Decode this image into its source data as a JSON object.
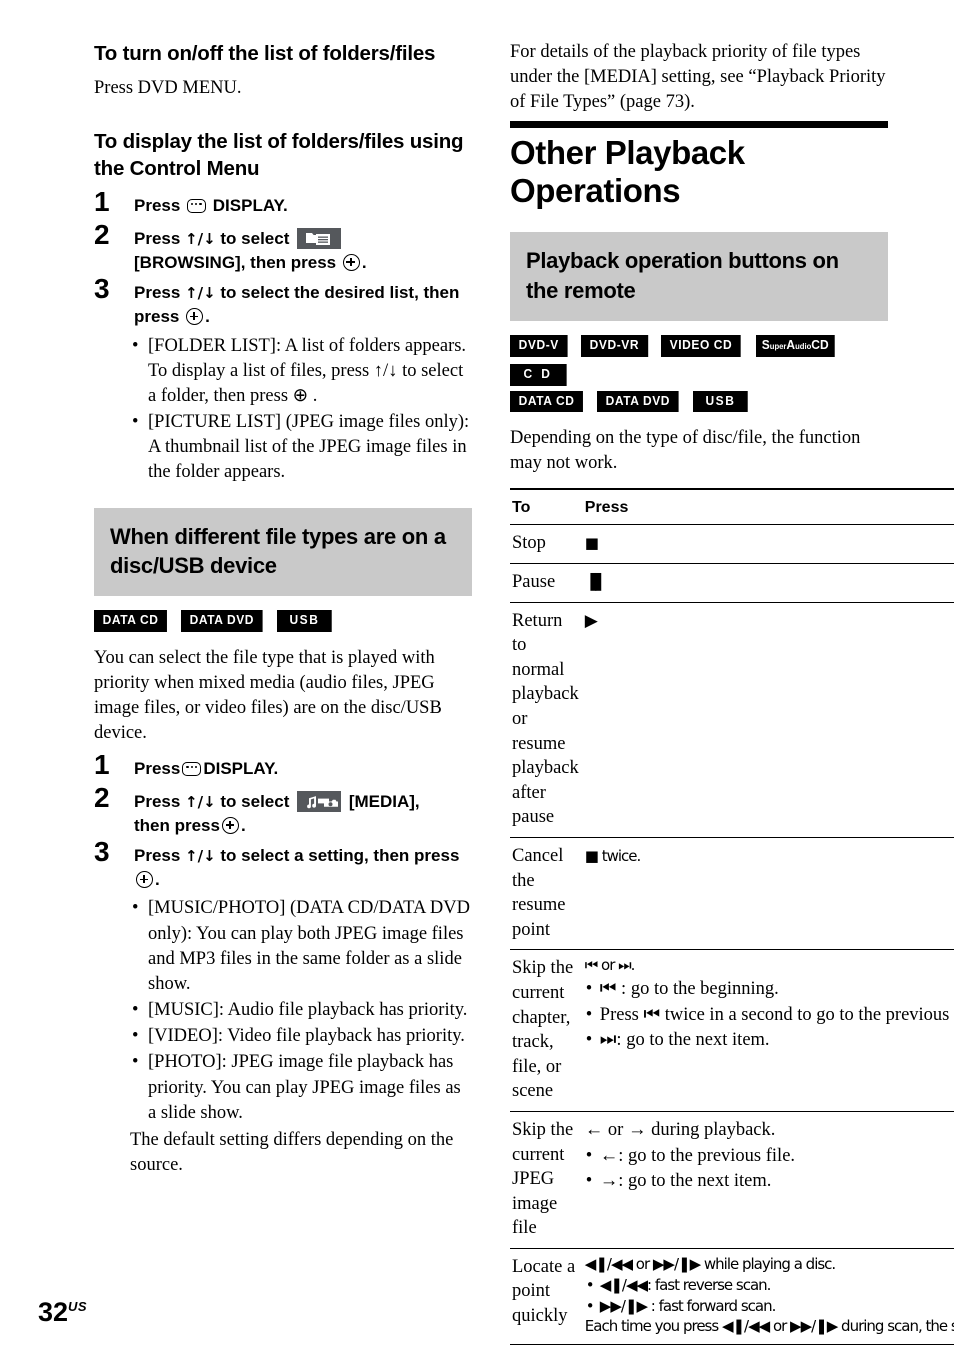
{
  "page": {
    "number": "32",
    "region": "US"
  },
  "left_column": {
    "heading_1": "To turn on/off the list of folders/files",
    "para_1": "Press DVD MENU.",
    "heading_2": "To display the list of folders/files using the Control Menu",
    "steps_1": [
      {
        "num": "1",
        "parts": [
          "Press ",
          "DISPLAY."
        ],
        "icon": "display-icon"
      },
      {
        "num": "2",
        "parts": [
          "Press ",
          "↑/↓",
          " to select ",
          "[BROWSING], then press ",
          "."
        ],
        "icon": "browsing-icon"
      },
      {
        "num": "3",
        "parts": [
          "Press ",
          "↑/↓",
          " to select the desired list, then press ",
          "."
        ]
      }
    ],
    "step3_bullets": [
      "[FOLDER LIST]: A list of folders appears. To display a list of files, press ↑/↓ to select a folder, then press ⊕ .",
      "[PICTURE LIST] (JPEG image files only): A thumbnail list of the JPEG image files in the folder appears."
    ],
    "gray_heading": "When different file types are on a disc/USB device",
    "badges": [
      "DATA CD",
      "DATA DVD",
      "USB"
    ],
    "para_2": "You can select the file type that is played with priority when mixed media (audio files, JPEG image files, or video files) are on the disc/USB device.",
    "steps_2": [
      {
        "num": "1",
        "label": "Press DISPLAY."
      },
      {
        "num": "2",
        "label": "Press ↑/↓ to select [MEDIA], then press ⊕ ."
      },
      {
        "num": "3",
        "label": "Press ↑/↓ to select a setting, then press ⊕ ."
      }
    ],
    "media_bullets": [
      "[MUSIC/PHOTO] (DATA CD/DATA DVD only): You can play both JPEG image files and MP3 files in the same folder as a slide show.",
      "[MUSIC]: Audio file playback has priority.",
      "[VIDEO]: Video file playback has priority.",
      "[PHOTO]: JPEG image file playback has priority. You can play JPEG image files as a slide show."
    ],
    "closing_note": "The default setting differs depending on the source."
  },
  "right_column": {
    "intro_para": "For details of the playback priority of file types under the [MEDIA] setting, see “Playback Priority of File Types” (page 73).",
    "chapter_title": "Other Playback Operations",
    "gray_heading": "Playback operation buttons on the remote",
    "badges_row1": [
      "DVD-V",
      "DVD-VR",
      "VIDEO CD",
      "SuperAudioCD",
      "C D"
    ],
    "badges_row2": [
      "DATA CD",
      "DATA DVD",
      "USB"
    ],
    "note_para": "Depending on the type of disc/file, the function may not work.",
    "table": {
      "headers": [
        "To",
        "Press"
      ],
      "rows": [
        {
          "to": "Stop",
          "press_lead": "■",
          "press_bullets": []
        },
        {
          "to": "Pause",
          "press_lead": "▐▌",
          "press_bullets": []
        },
        {
          "to": "Return to normal playback or resume playback after pause",
          "press_lead": "▶",
          "press_bullets": []
        },
        {
          "to": "Cancel the resume point",
          "press_lead": "■ twice.",
          "press_bullets": []
        },
        {
          "to": "Skip the current chapter, track, file, or scene",
          "press_lead": "⏮ or ⏭.",
          "press_bullets": [
            "⏮ : go to the beginning.",
            "Press ⏮ twice in a second to go to the previous item.",
            "⏭: go to the next item."
          ]
        },
        {
          "to": "Skip the current JPEG image file",
          "press_lead": "← or → during playback.",
          "press_bullets": [
            "←: go to the previous file.",
            "→: go to the next item."
          ]
        },
        {
          "to": "Locate a point quickly",
          "press_lead": "◀❚/◀◀ or ▶▶/❚▶ while playing a disc.",
          "press_bullets": [
            "◀❚/◀◀: fast reverse scan.",
            "▶▶/❚▶ : fast forward scan."
          ],
          "press_tail": "Each time you press ◀❚/◀◀ or ▶▶/❚▶ during scan, the scan speed changes."
        }
      ]
    }
  }
}
